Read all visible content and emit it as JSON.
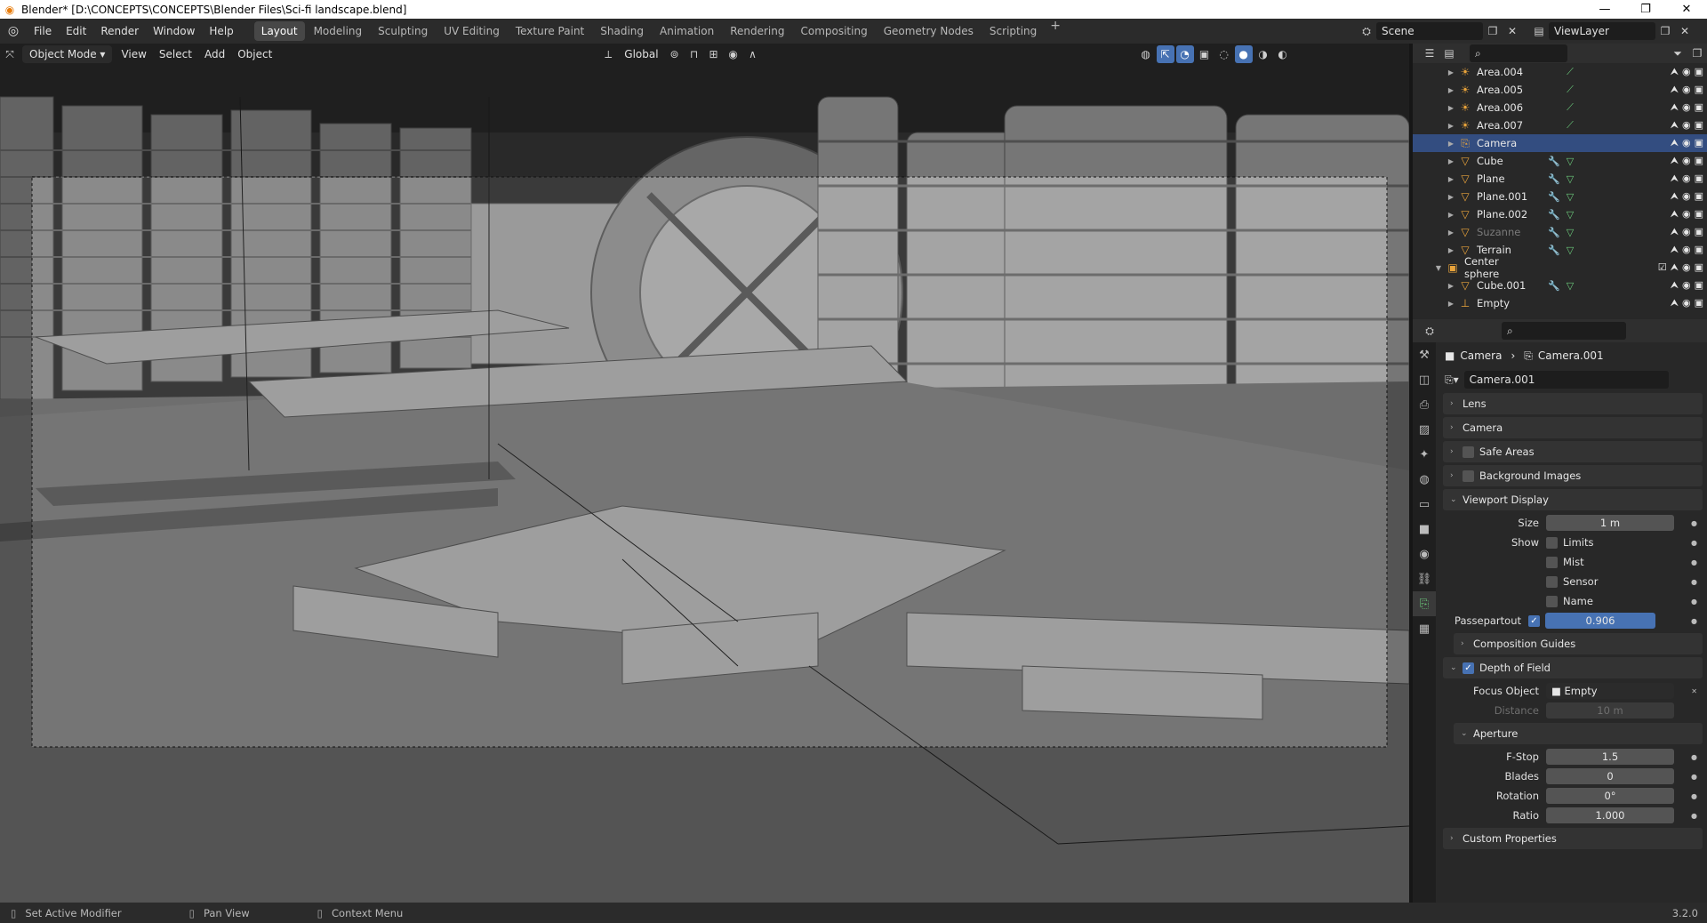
{
  "window": {
    "title": "Blender* [D:\\CONCEPTS\\CONCEPTS\\Blender Files\\Sci-fi landscape.blend]",
    "min": "—",
    "max": "❐",
    "close": "✕"
  },
  "menu": [
    "File",
    "Edit",
    "Render",
    "Window",
    "Help"
  ],
  "workspaces": [
    "Layout",
    "Modeling",
    "Sculpting",
    "UV Editing",
    "Texture Paint",
    "Shading",
    "Animation",
    "Rendering",
    "Compositing",
    "Geometry Nodes",
    "Scripting"
  ],
  "active_workspace": "Layout",
  "scene": "Scene",
  "view_layer": "ViewLayer",
  "viewport_header": {
    "mode": "Object Mode",
    "menus": [
      "View",
      "Select",
      "Add",
      "Object"
    ],
    "orientation": "Global"
  },
  "outliner": {
    "rows": [
      {
        "name": "Area.004",
        "icon": "light-icon",
        "sel": false
      },
      {
        "name": "Area.005",
        "icon": "light-icon",
        "sel": false
      },
      {
        "name": "Area.006",
        "icon": "light-icon",
        "sel": false
      },
      {
        "name": "Area.007",
        "icon": "light-icon",
        "sel": false
      },
      {
        "name": "Camera",
        "icon": "camera-icon",
        "sel": true
      },
      {
        "name": "Cube",
        "icon": "mesh-icon",
        "sel": false
      },
      {
        "name": "Plane",
        "icon": "mesh-icon",
        "sel": false
      },
      {
        "name": "Plane.001",
        "icon": "mesh-icon",
        "sel": false
      },
      {
        "name": "Plane.002",
        "icon": "mesh-icon",
        "sel": false
      },
      {
        "name": "Suzanne",
        "icon": "mesh-icon",
        "sel": false
      },
      {
        "name": "Terrain",
        "icon": "mesh-icon",
        "sel": false
      },
      {
        "name": "Center sphere",
        "icon": "collection-icon",
        "sel": false
      },
      {
        "name": "Cube.001",
        "icon": "mesh-icon",
        "sel": false
      },
      {
        "name": "Empty",
        "icon": "empty-icon",
        "sel": false
      }
    ]
  },
  "properties": {
    "breadcrumb_object": "Camera",
    "breadcrumb_data": "Camera.001",
    "data_name": "Camera.001",
    "panels": {
      "lens": "Lens",
      "camera": "Camera",
      "safe_areas": "Safe Areas",
      "background_images": "Background Images",
      "viewport_display": "Viewport Display",
      "composition_guides": "Composition Guides",
      "dof": "Depth of Field",
      "aperture": "Aperture",
      "custom_properties": "Custom Properties"
    },
    "size_label": "Size",
    "size": "1 m",
    "show_label": "Show",
    "show_items": [
      "Limits",
      "Mist",
      "Sensor",
      "Name"
    ],
    "passepartout_label": "Passepartout",
    "passepartout": "0.906",
    "focus_object_label": "Focus Object",
    "focus_object": "Empty",
    "distance_label": "Distance",
    "distance": "10 m",
    "fstop_label": "F-Stop",
    "fstop": "1.5",
    "blades_label": "Blades",
    "blades": "0",
    "rotation_label": "Rotation",
    "rotation": "0°",
    "ratio_label": "Ratio",
    "ratio": "1.000"
  },
  "status": {
    "left": "Set Active Modifier",
    "mid": "Pan View",
    "right": "Context Menu",
    "version": "3.2.0"
  }
}
